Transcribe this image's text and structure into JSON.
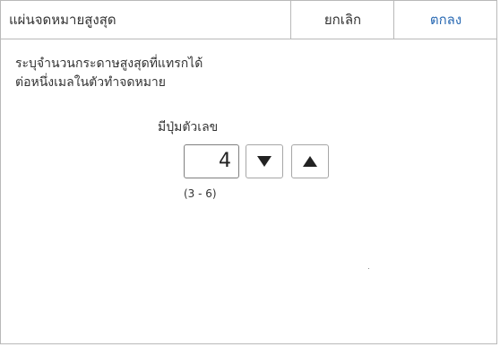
{
  "header": {
    "title": "แผ่นจดหมายสูงสุด",
    "cancel_label": "ยกเลิก",
    "ok_label": "ตกลง"
  },
  "description": {
    "line1": "ระบุจำนวนกระดาษสูงสุดที่แทรกได้",
    "line2": "ต่อหนึ่งเมลในตัวทำจดหมาย"
  },
  "numeric_input": {
    "label": "มีปุ่มตัวเลข",
    "value": "4",
    "range": "(3 - 6)"
  },
  "icons": {
    "down": "triangle-down-icon",
    "up": "triangle-up-icon"
  },
  "colors": {
    "accent": "#2a6ab3",
    "border": "#b9b9b9"
  }
}
